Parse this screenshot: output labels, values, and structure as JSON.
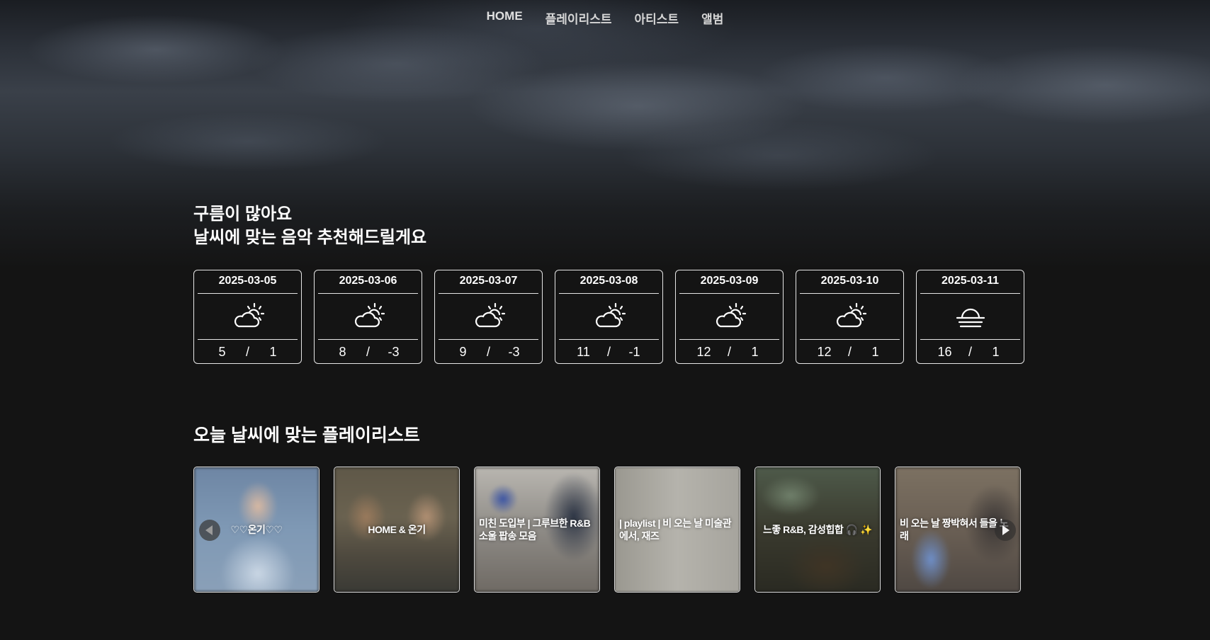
{
  "nav": {
    "items": [
      {
        "label": "HOME"
      },
      {
        "label": "플레이리스트"
      },
      {
        "label": "아티스트"
      },
      {
        "label": "앨범"
      }
    ]
  },
  "hero": {
    "line1": "구름이 많아요",
    "line2": "날씨에 맞는 음악 추천해드릴게요"
  },
  "forecast": [
    {
      "date": "2025-03-05",
      "icon": "partly-cloudy-icon",
      "high": "5",
      "sep": "/",
      "low": "1"
    },
    {
      "date": "2025-03-06",
      "icon": "partly-cloudy-icon",
      "high": "8",
      "sep": "/",
      "low": "-3"
    },
    {
      "date": "2025-03-07",
      "icon": "partly-cloudy-icon",
      "high": "9",
      "sep": "/",
      "low": "-3"
    },
    {
      "date": "2025-03-08",
      "icon": "partly-cloudy-icon",
      "high": "11",
      "sep": "/",
      "low": "-1"
    },
    {
      "date": "2025-03-09",
      "icon": "partly-cloudy-icon",
      "high": "12",
      "sep": "/",
      "low": "1"
    },
    {
      "date": "2025-03-10",
      "icon": "partly-cloudy-icon",
      "high": "12",
      "sep": "/",
      "low": "1"
    },
    {
      "date": "2025-03-11",
      "icon": "fog-icon",
      "high": "16",
      "sep": "/",
      "low": "1"
    }
  ],
  "playlists": {
    "title": "오늘 날씨에 맞는 플레이리스트",
    "items": [
      {
        "title": "♡♡온기♡♡"
      },
      {
        "title": "HOME & 온기"
      },
      {
        "title": "미친 도입부 | 그루브한 R&B 소울 팝송 모음"
      },
      {
        "title": "| playlist | 비 오는 날 미술관에서, 재즈"
      },
      {
        "title": "느좋 R&B, 감성힙합 🎧 ✨"
      },
      {
        "title": "비 오는 날 짱박혀서 들을 노래"
      }
    ],
    "prev_icon": "chevron-left-icon",
    "next_icon": "chevron-right-icon"
  }
}
